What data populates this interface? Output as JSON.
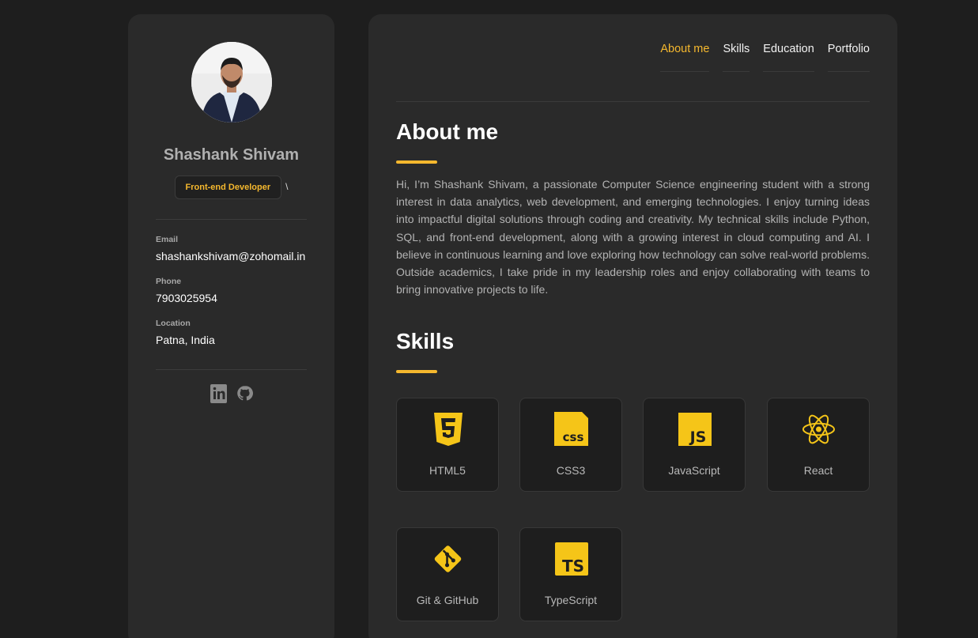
{
  "profile": {
    "name": "Shashank Shivam",
    "role": "Front-end Developer",
    "role_suffix": "\\",
    "contacts": [
      {
        "label": "Email",
        "value": "shashankshivam@zohomail.in"
      },
      {
        "label": "Phone",
        "value": "7903025954"
      },
      {
        "label": "Location",
        "value": "Patna, India"
      }
    ],
    "socials": [
      "linkedin-icon",
      "github-icon"
    ]
  },
  "nav": {
    "items": [
      "About me",
      "Skills",
      "Education",
      "Portfolio"
    ],
    "active": "About me"
  },
  "about": {
    "title": "About me",
    "text": "Hi, I’m Shashank Shivam, a passionate Computer Science engineering student with a strong interest in data analytics, web development, and emerging technologies. I enjoy turning ideas into impactful digital solutions through coding and creativity. My technical skills include Python, SQL, and front-end development, along with a growing interest in cloud computing and AI. I believe in continuous learning and love exploring how technology can solve real-world problems. Outside academics, I take pride in my leadership roles and enjoy collaborating with teams to bring innovative projects to life."
  },
  "skills": {
    "title": "Skills",
    "items": [
      {
        "label": "HTML5",
        "icon": "html5-icon"
      },
      {
        "label": "CSS3",
        "icon": "css3-icon"
      },
      {
        "label": "JavaScript",
        "icon": "javascript-icon"
      },
      {
        "label": "React",
        "icon": "react-icon"
      },
      {
        "label": "Git & GitHub",
        "icon": "git-icon"
      },
      {
        "label": "TypeScript",
        "icon": "typescript-icon"
      }
    ]
  },
  "colors": {
    "accent": "#f5b82e",
    "background": "#1e1e1e",
    "card": "#2a2a2a"
  }
}
